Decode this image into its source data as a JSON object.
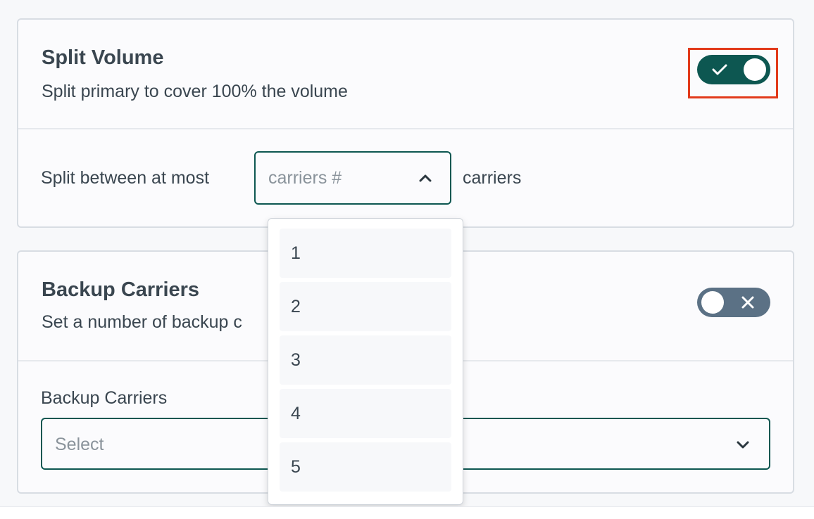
{
  "split_volume": {
    "title": "Split Volume",
    "subtitle": "Split primary to cover 100% the volume",
    "toggle_on": true,
    "split_label_before": "Split between at most",
    "split_label_after": "carriers",
    "carriers_select": {
      "placeholder": "carriers #",
      "open": true,
      "options": [
        "1",
        "2",
        "3",
        "4",
        "5"
      ]
    }
  },
  "backup_carriers": {
    "title": "Backup Carriers",
    "subtitle": "Set a number of backup c",
    "toggle_on": false,
    "field_label": "Backup Carriers",
    "select_placeholder": "Select"
  },
  "colors": {
    "accent": "#0d5751",
    "toggle_off": "#5b7185",
    "highlight": "#e23a1b"
  },
  "icons": {
    "toggle_on": "check-icon",
    "toggle_off": "close-icon",
    "select_open": "chevron-up-icon",
    "select_closed": "chevron-down-icon"
  }
}
